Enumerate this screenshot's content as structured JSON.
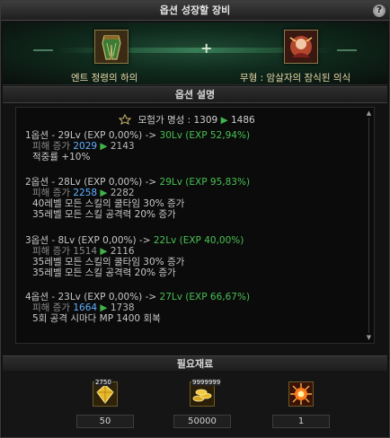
{
  "window": {
    "title": "옵션 성장할 장비",
    "help_label": "?"
  },
  "equip": {
    "left_item_name": "엔트 정령의 하의",
    "left_item_icon": "leg-armor-icon",
    "plus": "+",
    "right_item_name": "무형 : 암살자의 잠식된 의식",
    "right_item_icon": "assassin-soul-icon"
  },
  "description": {
    "header": "옵션 설명",
    "fame": {
      "label": "모험가 명성 :",
      "from": "1309",
      "arrow": "▶",
      "to": "1486"
    },
    "options": [
      {
        "head_prefix": "1옵션 - 29Lv (EXP 0,00%) ->",
        "head_to": "30Lv (EXP 52,94%)",
        "dmg_label": "피해 증가",
        "dmg_from": "2029",
        "dmg_arrow": "▶",
        "dmg_to": "2143",
        "effects": [
          "적중률 +10%"
        ]
      },
      {
        "head_prefix": "2옵션 - 28Lv (EXP 0,00%) ->",
        "head_to": "29Lv (EXP 95,83%)",
        "dmg_label": "피해 증가",
        "dmg_from": "2258",
        "dmg_arrow": "▶",
        "dmg_to": "2282",
        "effects": [
          "40레벨 모든 스킬의 쿨타임 30% 증가",
          "35레벨 모든 스킬 공격력 20% 증가"
        ]
      },
      {
        "head_prefix": "3옵션 - 8Lv (EXP 0,00%) ->",
        "head_to": "22Lv (EXP 40,00%)",
        "dmg_label": "피해 증가",
        "dmg_from": "1514",
        "dmg_arrow": "▶",
        "dmg_to": "2116",
        "effects": [
          "35레벨 모든 스킬의 쿨타임 30% 증가",
          "35레벨 모든 스킬 공격력 20% 증가"
        ]
      },
      {
        "head_prefix": "4옵션 - 23Lv (EXP 0,00%) ->",
        "head_to": "27Lv (EXP 66,67%)",
        "dmg_label": "피해 증가",
        "dmg_from": "1664",
        "dmg_arrow": "▶",
        "dmg_to": "1738",
        "effects": [
          "5회 공격 시마다 MP 1400 회복"
        ]
      }
    ]
  },
  "materials": {
    "header": "필요재료",
    "items": [
      {
        "icon": "gold-crystal-icon",
        "badge": "2750",
        "count": "50"
      },
      {
        "icon": "gold-coins-icon",
        "badge": "9999999",
        "count": "50000"
      },
      {
        "icon": "burst-orb-icon",
        "badge": "",
        "count": "1"
      }
    ]
  },
  "colors": {
    "value_blue": "#5fb1ff",
    "level_green": "#47c052",
    "item_name_gold": "#e8d9a6"
  }
}
